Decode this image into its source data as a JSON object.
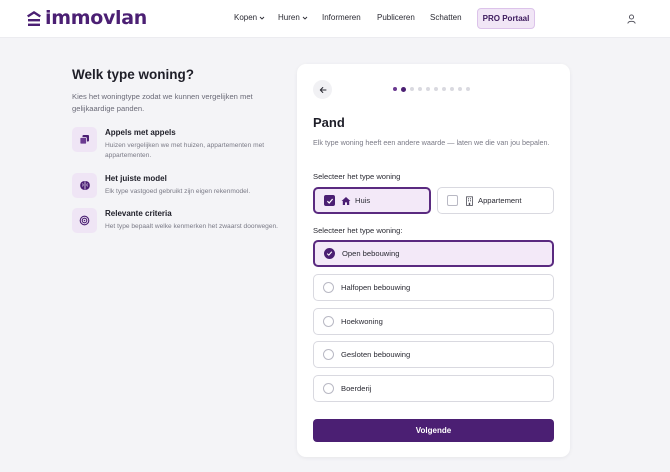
{
  "brand": {
    "name": "immovlan",
    "accent": "#4b1f73"
  },
  "nav": {
    "items": [
      {
        "label": "Kopen",
        "has_dropdown": true
      },
      {
        "label": "Huren",
        "has_dropdown": true
      },
      {
        "label": "Informeren",
        "has_dropdown": false
      },
      {
        "label": "Publiceren",
        "has_dropdown": false
      },
      {
        "label": "Schatten",
        "has_dropdown": false
      }
    ],
    "pro_label": "PRO Portaal",
    "user_icon": "user-icon"
  },
  "intro": {
    "title": "Welk type woning?",
    "subtitle": "Kies het woningtype zodat we kunnen vergelijken met gelijkaardige panden.",
    "features": [
      {
        "icon": "copy-icon",
        "title": "Appels met appels",
        "text": "Huizen vergelijken we met huizen, appartementen met appartementen."
      },
      {
        "icon": "brain-icon",
        "title": "Het juiste model",
        "text": "Elk type vastgoed gebruikt zijn eigen rekenmodel."
      },
      {
        "icon": "target-icon",
        "title": "Relevante criteria",
        "text": "Het type bepaalt welke kenmerken het zwaarst doorwegen."
      }
    ]
  },
  "wizard": {
    "back_icon": "arrow-left-icon",
    "steps_total": 10,
    "current_step": 2,
    "title": "Pand",
    "subtitle": "Elk type woning heeft een andere waarde — laten we die van jou bepalen.",
    "type_label": "Selecteer het type woning",
    "types": [
      {
        "label": "Huis",
        "icon": "home-icon",
        "selected": true
      },
      {
        "label": "Appartement",
        "icon": "building-icon",
        "selected": false
      }
    ],
    "subtype_label": "Selecteer het type woning:",
    "subtypes": [
      {
        "label": "Open bebouwing",
        "selected": true
      },
      {
        "label": "Halfopen bebouwing",
        "selected": false
      },
      {
        "label": "Hoekwoning",
        "selected": false
      },
      {
        "label": "Gesloten bebouwing",
        "selected": false
      },
      {
        "label": "Boerderij",
        "selected": false
      }
    ],
    "next_label": "Volgende"
  }
}
